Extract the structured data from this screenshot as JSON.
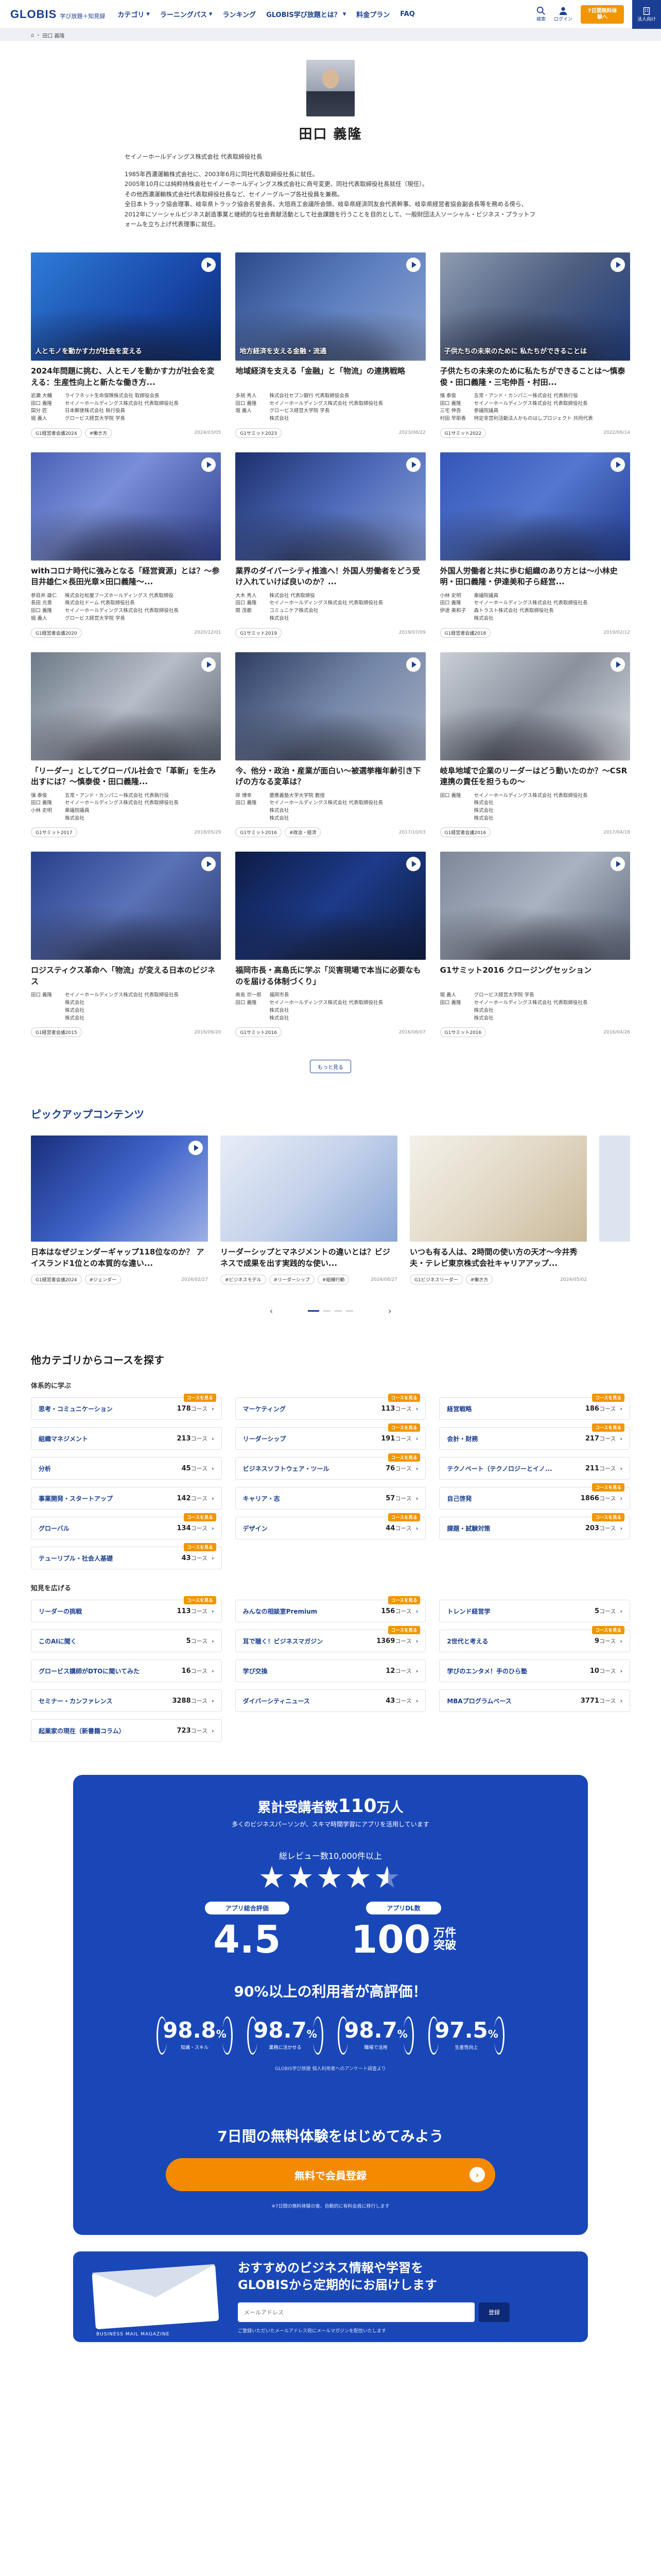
{
  "header": {
    "brand": "GLOBIS",
    "brand_sub": "学び放題＋知見録",
    "nav": [
      "カテゴリ",
      "ラーニングパス",
      "ランキング",
      "GLOBIS学び放題とは？",
      "料金プラン",
      "FAQ"
    ],
    "search_label": "検索",
    "login_label": "ログイン",
    "trial_label": "7日間無料体験へ",
    "cart_label": "法人向け"
  },
  "breadcrumb": {
    "current": "田口 義隆"
  },
  "profile": {
    "name": "田口 義隆",
    "role": "セイノーホールディングス株式会社 代表取締役社長",
    "bio": [
      "1985年西濃運輸株式会社に、2003年6月に同社代表取締役社長に就任。",
      "2005年10月には純粋持株会社セイノーホールディングス株式会社に商号変更、同社代表取締役社長就任（現任）。",
      "その他西濃運輸株式会社代表取締役社長など、セイノーグループ各社役員を兼務。",
      "全日本トラック協会理事、岐阜県トラック協会名誉会長、大垣商工会議所会頭、岐阜県経済同友会代表幹事、岐阜県経営者協会副会長等を務める傍ら、2012年にソーシャルビジネス創造事業と継続的な社会貢献活動として社会課題を行うことを目的として、一般財団法人ソーシャル・ビジネス・プラットフォームを立ち上げ代表理事に就任。"
    ]
  },
  "videos": [
    {
      "cap": "人とモノを動かす力が社会を変える",
      "title": "2024年問題に挑む、人とモノを動かす力が社会を変える：生産性向上と新たな働き方...",
      "speakers": [
        [
          "岩瀬 大輔",
          "ライフネット生命保険株式会社 取締役会長"
        ],
        [
          "田口 義隆",
          "セイノーホールディングス株式会社 代表取締役社長"
        ],
        [
          "国分 匠",
          "日本郵便株式会社 執行役員"
        ],
        [
          "堀 義人",
          "グロービス経営大学院 学長"
        ]
      ],
      "tags": [
        "G1経営者会議2024",
        "#働き方"
      ],
      "date": "2024/03/05"
    },
    {
      "cap": "地方経済を支える金融・流通",
      "title": "地域経済を支える「金融」と「物流」の連携戦略",
      "speakers": [
        [
          "多胡 秀人",
          "株式会社セブン銀行 代表取締役会長"
        ],
        [
          "田口 義隆",
          "セイノーホールディングス株式会社 代表取締役社長"
        ],
        [
          "堀 義人",
          "グロービス経営大学院 学長"
        ],
        [
          "",
          "株式会社"
        ]
      ],
      "tags": [
        "G1サミット2023"
      ],
      "date": "2023/08/22"
    },
    {
      "cap": "子供たちの未来のために 私たちができることは",
      "title": "子供たちの未来のために私たちができることは～慎泰俊・田口義隆・三宅伸吾・村田...",
      "speakers": [
        [
          "慎 泰俊",
          "五常・アンド・カンパニー株式会社 代表執行役"
        ],
        [
          "田口 義隆",
          "セイノーホールディングス株式会社 代表取締役社長"
        ],
        [
          "三宅 伸吾",
          "参議院議員"
        ],
        [
          "村田 早耶香",
          "特定非営利活動法人かものはしプロジェクト 共同代表"
        ]
      ],
      "tags": [
        "G1サミット2022"
      ],
      "date": "2022/06/14"
    },
    {
      "cap": "",
      "title": "withコロナ時代に強みとなる「経営資源」とは？～参目井雄仁×長田光章×田口義隆～...",
      "speakers": [
        [
          "参目井 雄仁",
          "株式会社松屋フーズホールディングス 代表取締役"
        ],
        [
          "長田 光章",
          "株式会社ドーム 代表取締役社長"
        ],
        [
          "田口 義隆",
          "セイノーホールディングス株式会社 代表取締役社長"
        ],
        [
          "堀 義人",
          "グロービス経営大学院 学長"
        ]
      ],
      "tags": [
        "G1経営者会議2020"
      ],
      "date": "2020/12/01"
    },
    {
      "cap": "",
      "title": "業界のダイバーシティ推進へ！外国人労働者をどう受け入れていけば良いのか？...",
      "speakers": [
        [
          "大木 秀人",
          "株式会社 代表取締役"
        ],
        [
          "田口 義隆",
          "セイノーホールディングス株式会社 代表取締役社長"
        ],
        [
          "関 茂都",
          "コミュニケア株式会社"
        ],
        [
          "",
          "株式会社"
        ]
      ],
      "tags": [
        "G1サミット2019"
      ],
      "date": "2019/07/09"
    },
    {
      "cap": "",
      "title": "外国人労働者と共に歩む組織のあり方とは～小林史明・田口義隆・伊達美和子ら経営...",
      "speakers": [
        [
          "小林 史明",
          "衆議院議員"
        ],
        [
          "田口 義隆",
          "セイノーホールディングス株式会社 代表取締役社長"
        ],
        [
          "伊達 美和子",
          "森トラスト株式会社 代表取締役社長"
        ],
        [
          "",
          "株式会社"
        ]
      ],
      "tags": [
        "G1経営者会議2018"
      ],
      "date": "2019/02/12"
    },
    {
      "cap": "",
      "title": "「リーダー」としてグローバル社会で「革新」を生み出すには？～慎泰俊・田口義隆...",
      "speakers": [
        [
          "慎 泰俊",
          "五常・アンド・カンパニー株式会社 代表執行役"
        ],
        [
          "田口 義隆",
          "セイノーホールディングス株式会社 代表取締役社長"
        ],
        [
          "小林 史明",
          "衆議院議員"
        ],
        [
          "",
          "株式会社"
        ]
      ],
      "tags": [
        "G1サミット2017"
      ],
      "date": "2018/05/29"
    },
    {
      "cap": "",
      "title": "今、他分・政治・産業が面白い～被選挙権年齢引き下げの方なる変革は？",
      "speakers": [
        [
          "岸 博幸",
          "慶應義塾大学大学院 教授"
        ],
        [
          "田口 義隆",
          "セイノーホールディングス株式会社 代表取締役社長"
        ],
        [
          "",
          "株式会社"
        ],
        [
          "",
          "株式会社"
        ]
      ],
      "tags": [
        "G1サミット2016",
        "#政治・経済"
      ],
      "date": "2017/10/03"
    },
    {
      "cap": "",
      "title": "岐阜地域で企業のリーダーはどう動いたのか？～CSR連携の責任を担うもの～",
      "speakers": [
        [
          "田口 義隆",
          "セイノーホールディングス株式会社 代表取締役社長"
        ],
        [
          "",
          "株式会社"
        ],
        [
          "",
          "株式会社"
        ],
        [
          "",
          "株式会社"
        ]
      ],
      "tags": [
        "G1経営者会議2016"
      ],
      "date": "2017/04/18"
    },
    {
      "cap": "",
      "title": "ロジスティクス革命へ「物流」が変える日本のビジネス",
      "speakers": [
        [
          "田口 義隆",
          "セイノーホールディングス株式会社 代表取締役社長"
        ],
        [
          "",
          "株式会社"
        ],
        [
          "",
          "株式会社"
        ],
        [
          "",
          "株式会社"
        ]
      ],
      "tags": [
        "G1経営者会議2015"
      ],
      "date": "2016/09/20"
    },
    {
      "cap": "",
      "title": "福岡市長・高島氏に学ぶ「災害現場で本当に必要なものを届ける体制づくり」",
      "speakers": [
        [
          "高島 宗一郎",
          "福岡市長"
        ],
        [
          "田口 義隆",
          "セイノーホールディングス株式会社 代表取締役社長"
        ],
        [
          "",
          "株式会社"
        ],
        [
          "",
          "株式会社"
        ]
      ],
      "tags": [
        "G1サミット2016"
      ],
      "date": "2016/06/07"
    },
    {
      "cap": "",
      "title": "G1サミット2016 クロージングセッション",
      "speakers": [
        [
          "堀 義人",
          "グロービス経営大学院 学長"
        ],
        [
          "田口 義隆",
          "セイノーホールディングス株式会社 代表取締役社長"
        ],
        [
          "",
          "株式会社"
        ],
        [
          "",
          "株式会社"
        ]
      ],
      "tags": [
        "G1サミット2016"
      ],
      "date": "2016/04/26"
    }
  ],
  "more_label": "もっと見る",
  "pickup": {
    "heading": "ピックアップコンテンツ",
    "items": [
      {
        "title": "日本はなぜジェンダーギャップ118位なのか？ アイスランド1位との本質的な違い...",
        "tags": [
          "G1経営者会議2024",
          "#ジェンダー"
        ],
        "date": "2024/02/27"
      },
      {
        "title": "リーダーシップとマネジメントの違いとは？ビジネスで成果を出す実践的な使い...",
        "tags": [
          "#ビジネスモデル",
          "#リーダーシップ",
          "#組織行動"
        ],
        "date": "2024/08/27"
      },
      {
        "title": "いつも有る人は、2時間の使い方の天才～今井秀夫・テレビ東京株式会社キャリアアップ...",
        "tags": [
          "G1ビジネスリーダー",
          "#働き方"
        ],
        "date": "2024/05/02"
      }
    ]
  },
  "categories": {
    "heading": "他カテゴリからコースを探す",
    "group1": "体系的に学ぶ",
    "items1": [
      {
        "name": "思考・コミュニケーション",
        "count": "178",
        "badge": "コースを見る"
      },
      {
        "name": "マーケティング",
        "count": "113",
        "badge": "コースを見る"
      },
      {
        "name": "経営戦略",
        "count": "186",
        "badge": "コースを見る"
      },
      {
        "name": "組織マネジメント",
        "count": "213",
        "badge": ""
      },
      {
        "name": "リーダーシップ",
        "count": "191",
        "badge": "コースを見る"
      },
      {
        "name": "会計・財務",
        "count": "217",
        "badge": "コースを見る"
      },
      {
        "name": "分析",
        "count": "45",
        "badge": ""
      },
      {
        "name": "ビジネスソフトウェア・ツール",
        "count": "76",
        "badge": "コースを見る"
      },
      {
        "name": "テクノベート（テクノロジーとイノ...",
        "count": "211",
        "badge": ""
      },
      {
        "name": "事業開発・スタートアップ",
        "count": "142",
        "badge": ""
      },
      {
        "name": "キャリア・志",
        "count": "57",
        "badge": ""
      },
      {
        "name": "自己啓発",
        "count": "1866",
        "badge": "コースを見る"
      },
      {
        "name": "グローバル",
        "count": "134",
        "badge": "コースを見る"
      },
      {
        "name": "デザイン",
        "count": "44",
        "badge": "コースを見る"
      },
      {
        "name": "課題・試験対策",
        "count": "203",
        "badge": "コースを見る"
      },
      {
        "name": "テューリプル・社会人基礎",
        "count": "43",
        "badge": "コースを見る"
      }
    ],
    "group2": "知見を広げる",
    "items2": [
      {
        "name": "リーダーの挑戦",
        "count": "113",
        "badge": "コースを見る"
      },
      {
        "name": "みんなの相談室Premium",
        "count": "156",
        "badge": "コースを見る"
      },
      {
        "name": "トレンド経営学",
        "count": "5",
        "badge": ""
      },
      {
        "name": "このAIに聞く",
        "count": "5",
        "badge": ""
      },
      {
        "name": "耳で聴く！ビジネスマガジン",
        "count": "1369",
        "badge": "コースを見る"
      },
      {
        "name": "2世代と考える",
        "count": "9",
        "badge": "コースを見る"
      },
      {
        "name": "グロービス講師がDTOに聞いてみた",
        "count": "16",
        "badge": ""
      },
      {
        "name": "学び交換",
        "count": "12",
        "badge": ""
      },
      {
        "name": "学びのエンタメ！手のひら塾",
        "count": "10",
        "badge": ""
      },
      {
        "name": "セミナー・カンファレンス",
        "count": "3288",
        "badge": ""
      },
      {
        "name": "ダイバーシティニュース",
        "count": "43",
        "badge": ""
      },
      {
        "name": "MBAプログラムベース",
        "count": "3771",
        "badge": ""
      },
      {
        "name": "起業家の現在（新書籍コラム）",
        "count": "723",
        "badge": ""
      }
    ],
    "count_suffix": "コース"
  },
  "promo": {
    "users_pre": "累計受講者数",
    "users_num": "110",
    "users_post": "万人",
    "users_sub": "多くのビジネスパーソンが、スキマ時間学習にアプリを活用しています",
    "reviews": "総レビュー数10,000件以上",
    "rating_label": "アプリ総合評価",
    "rating": "4.5",
    "rating_value": 4.5,
    "dl_label": "アプリDL数",
    "dl_num": "100",
    "dl_unit1": "万件",
    "dl_unit2": "突破",
    "pct": "90%以上の利用者が高評価！",
    "laurels": [
      {
        "v": "98.8",
        "l": "知識・スキル"
      },
      {
        "v": "98.7",
        "l": "業務に活かせる"
      },
      {
        "v": "98.7",
        "l": "職場で活用"
      },
      {
        "v": "97.5",
        "l": "生産性向上"
      }
    ],
    "note": "GLOBIS学び放題 個人利用者へのアンケート調査より",
    "free": "7日間の無料体験をはじめてみよう",
    "cta": "無料で会員登録",
    "cta_note": "※7日間の無料体験の後、自動的に有料会員に移行します"
  },
  "mail": {
    "env_text": "BUSINESS MAIL MAGAZINE",
    "title": "おすすめのビジネス情報や学習を\nGLOBISから定期的にお届けします",
    "placeholder": "メールアドレス",
    "btn": "登録",
    "note": "ご登録いただいたメールアドレス宛にメールマガジンを配信いたします"
  }
}
